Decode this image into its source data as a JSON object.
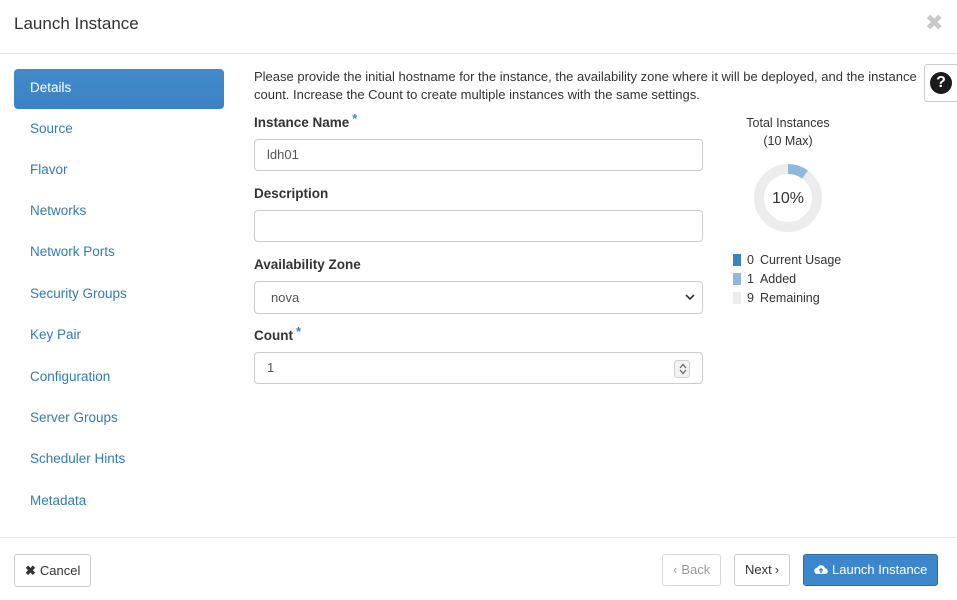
{
  "header": {
    "title": "Launch Instance",
    "close_glyph": "✖"
  },
  "sidebar": {
    "items": [
      {
        "label": "Details",
        "active": true
      },
      {
        "label": "Source"
      },
      {
        "label": "Flavor"
      },
      {
        "label": "Networks"
      },
      {
        "label": "Network Ports"
      },
      {
        "label": "Security Groups"
      },
      {
        "label": "Key Pair"
      },
      {
        "label": "Configuration"
      },
      {
        "label": "Server Groups"
      },
      {
        "label": "Scheduler Hints"
      },
      {
        "label": "Metadata"
      }
    ]
  },
  "details": {
    "help_text": "Please provide the initial hostname for the instance, the availability zone where it will be deployed, and the instance count. Increase the Count to create multiple instances with the same settings.",
    "help_icon": "question-icon",
    "required_mark": "*",
    "instance_name": {
      "label": "Instance Name",
      "value": "ldh01"
    },
    "description": {
      "label": "Description",
      "value": ""
    },
    "availability_zone": {
      "label": "Availability Zone",
      "value": "nova"
    },
    "count": {
      "label": "Count",
      "value": "1"
    }
  },
  "quota": {
    "title_line1": "Total Instances",
    "title_line2": "(10 Max)",
    "percent_label": "10%",
    "max": 10,
    "current_usage": 0,
    "added": 1,
    "remaining": 9,
    "legend": [
      {
        "count": "0",
        "label": "Current Usage",
        "color": "#3b82c4"
      },
      {
        "count": "1",
        "label": "Added",
        "color": "#8fb8de"
      },
      {
        "count": "9",
        "label": "Remaining",
        "color": "#ececec"
      }
    ]
  },
  "footer": {
    "cancel_label": "Cancel",
    "back_label": "Back",
    "next_label": "Next",
    "launch_label": "Launch Instance"
  },
  "colors": {
    "accent": "#3b82c4",
    "link": "#337ab7"
  }
}
